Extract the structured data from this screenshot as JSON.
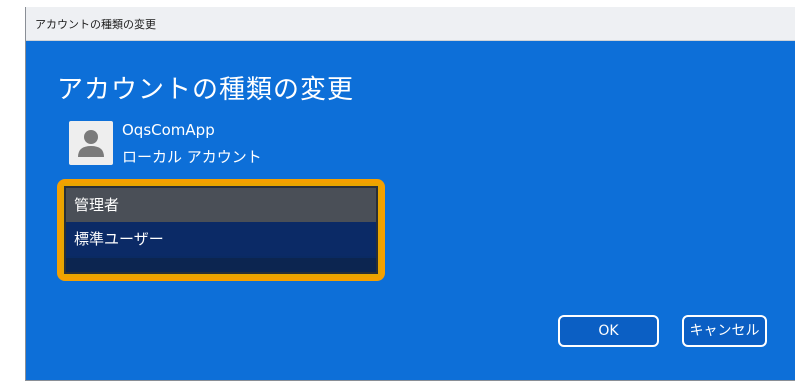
{
  "window": {
    "title": "アカウントの種類の変更",
    "heading": "アカウントの種類の変更"
  },
  "user": {
    "name": "OqsComApp",
    "account_type": "ローカル アカウント",
    "avatar_icon": "user-avatar-icon"
  },
  "account_type_list": {
    "items": [
      {
        "label": "管理者",
        "state": "highlighted"
      },
      {
        "label": "標準ユーザー",
        "state": "selected"
      }
    ]
  },
  "buttons": {
    "ok_label": "OK",
    "cancel_label": "キャンセル"
  },
  "colors": {
    "dialog_background": "#0d6fd8",
    "focus_outline": "#f4a000",
    "list_background": "#0a2a63",
    "highlight_row": "#4a4f57"
  }
}
